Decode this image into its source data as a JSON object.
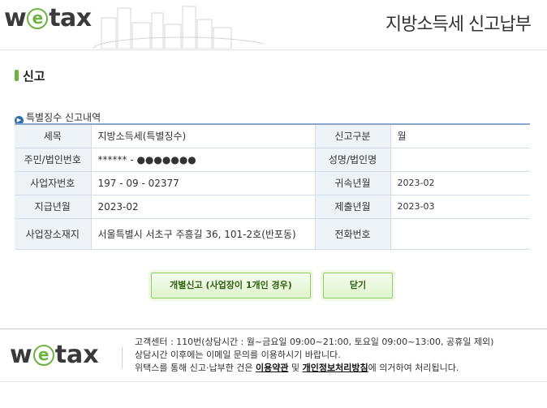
{
  "header": {
    "logo_pre": "w",
    "logo_e": "e",
    "logo_post": "tax",
    "title": "지방소득세 신고납부"
  },
  "section": {
    "title": "신고"
  },
  "subsection": {
    "title": "특별징수 신고내역"
  },
  "table": {
    "r1": {
      "h1": "세목",
      "v1": "지방소득세(특별징수)",
      "h2": "신고구분",
      "v2": "월"
    },
    "r2": {
      "h1": "주민/법인번호",
      "v1": "****** - ●●●●●●●",
      "h2": "성명/법인명",
      "v2": ""
    },
    "r3": {
      "h1": "사업자번호",
      "v1": "197 - 09 - 02377",
      "h2": "귀속년월",
      "v2": "2023-02"
    },
    "r4": {
      "h1": "지급년월",
      "v1": "2023-02",
      "h2": "제출년월",
      "v2": "2023-03"
    },
    "r5": {
      "h1": "사업장소재지",
      "v1": "서울특별시 서초구 주흥길 36, 101-2호(반포동)",
      "h2": "전화번호",
      "v2": ""
    }
  },
  "buttons": {
    "individual": "개별신고 (사업장이 1개인 경우)",
    "close": "닫기"
  },
  "footer": {
    "line1": "고객센터 : 110번(상담시간 : 월~금요일 09:00~21:00, 토요일 09:00~13:00, 공휴일 제외)",
    "line2": "상담시간 이후에는 이메일 문의를 이용하시기 바랍니다.",
    "line3_pre": "위택스를 통해 신고·납부한 건은 ",
    "terms": "이용약관",
    "line3_and": " 및 ",
    "privacy": "개인정보처리방침",
    "line3_post": "에 의거하여 처리됩니다."
  },
  "colors": {
    "accent_green": "#6cb33f",
    "table_border": "#8aa6c9",
    "header_bg": "#eef3f8"
  }
}
